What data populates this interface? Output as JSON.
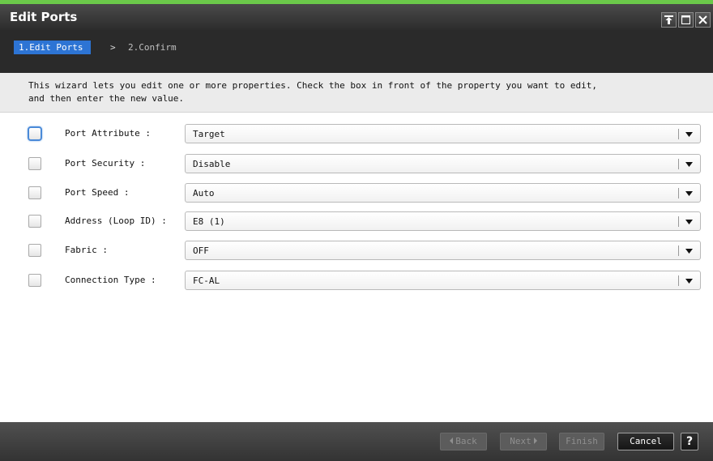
{
  "window": {
    "title": "Edit Ports",
    "accent_color": "#6bc94a",
    "controls": [
      "pin-icon",
      "maximize-icon",
      "close-icon"
    ]
  },
  "wizard": {
    "steps": [
      {
        "label": "1.Edit Ports",
        "active": true
      },
      {
        "label": "2.Confirm",
        "active": false
      }
    ],
    "separator": ">",
    "active_color": "#2d74d4"
  },
  "instructions": {
    "line1": "This wizard lets you edit one or more properties. Check the  box in front of the property you want to edit,",
    "line2": "and then enter the new value."
  },
  "properties": [
    {
      "label": "Port Attribute :",
      "value": "Target",
      "checked": false,
      "focused": true
    },
    {
      "label": "Port Security :",
      "value": "Disable",
      "checked": false,
      "focused": false
    },
    {
      "label": "Port Speed :",
      "value": "Auto",
      "checked": false,
      "focused": false
    },
    {
      "label": "Address (Loop ID) :",
      "value": "E8 (1)",
      "checked": false,
      "focused": false
    },
    {
      "label": "Fabric :",
      "value": "OFF",
      "checked": false,
      "focused": false
    },
    {
      "label": "Connection Type :",
      "value": "FC-AL",
      "checked": false,
      "focused": false
    }
  ],
  "footer": {
    "back_label": "Back",
    "next_label": "Next",
    "finish_label": "Finish",
    "cancel_label": "Cancel",
    "help_label": "?",
    "back_enabled": false,
    "next_enabled": false,
    "finish_enabled": false,
    "cancel_enabled": true
  }
}
